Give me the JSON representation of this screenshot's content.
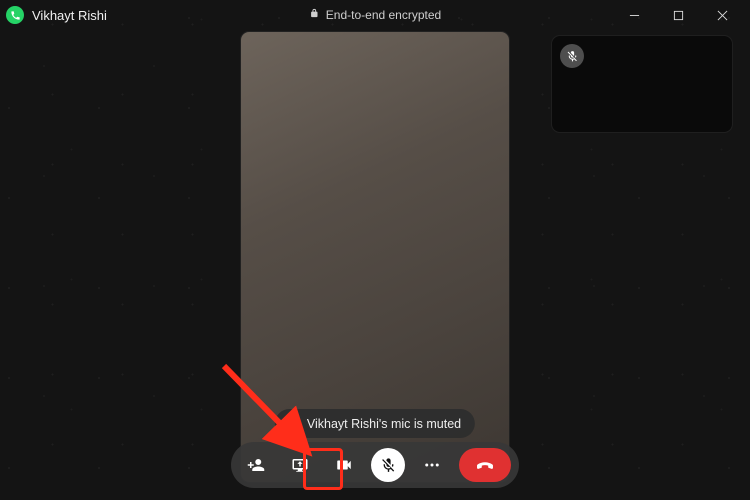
{
  "titlebar": {
    "contact_name": "Vikhayt Rishi",
    "encryption_label": "End-to-end encrypted"
  },
  "toast": {
    "message": "Vikhayt Rishi's mic is muted"
  },
  "icons": {
    "app": "whatsapp-icon",
    "lock": "lock-icon",
    "minimize": "minimize-icon",
    "maximize": "maximize-icon",
    "close": "close-icon",
    "self_mute": "mic-off-icon",
    "toast_mute": "mic-off-icon",
    "add_participant": "add-person-icon",
    "screen_share": "screen-share-icon",
    "camera": "video-icon",
    "mic": "mic-off-icon",
    "more": "more-icon",
    "end_call": "end-call-icon"
  },
  "colors": {
    "brand": "#25d366",
    "end_call": "#e03131",
    "annotation": "#ff2d1a"
  }
}
